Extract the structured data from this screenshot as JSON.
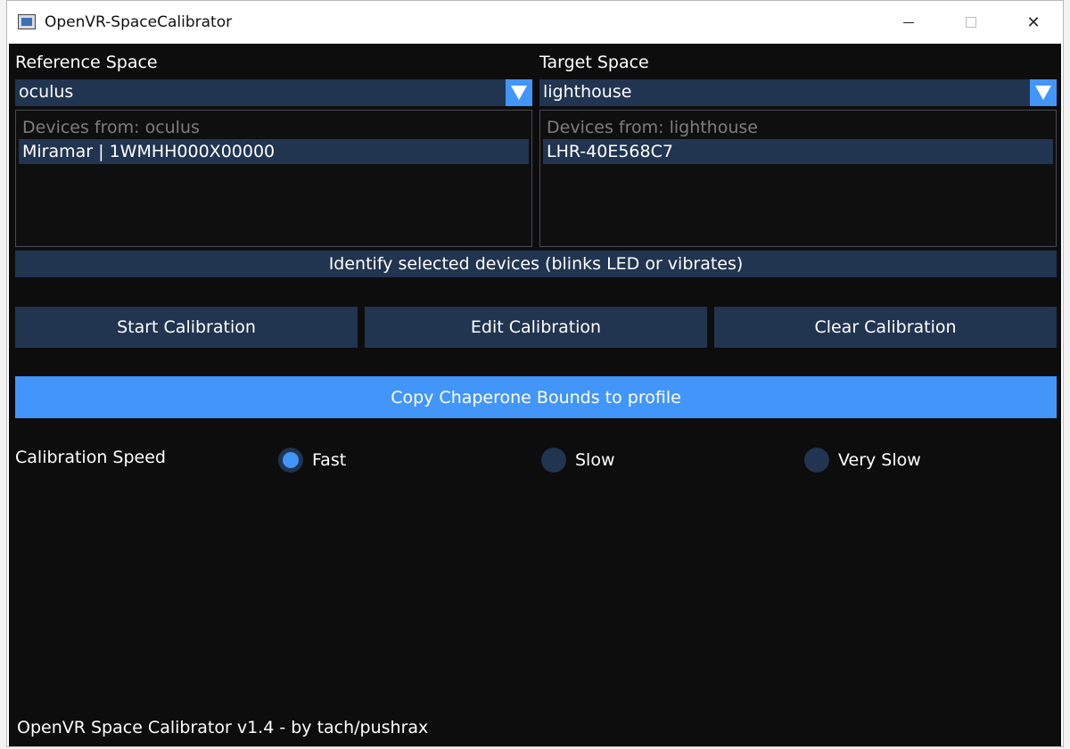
{
  "window": {
    "title": "OpenVR-SpaceCalibrator"
  },
  "reference": {
    "label": "Reference Space",
    "selected": "oculus",
    "list_header": "Devices from: oculus",
    "devices": [
      "Miramar | 1WMHH000X00000"
    ]
  },
  "target": {
    "label": "Target Space",
    "selected": "lighthouse",
    "list_header": "Devices from: lighthouse",
    "devices": [
      "LHR-40E568C7"
    ]
  },
  "buttons": {
    "identify": "Identify selected devices (blinks LED or vibrates)",
    "start": "Start Calibration",
    "edit": "Edit Calibration",
    "clear": "Clear Calibration",
    "copy_chaperone": "Copy Chaperone Bounds to profile"
  },
  "speed": {
    "label": "Calibration Speed",
    "options": [
      "Fast",
      "Slow",
      "Very Slow"
    ],
    "selected": "Fast"
  },
  "footer": "OpenVR Space Calibrator v1.4 - by tach/pushrax",
  "colors": {
    "background": "#0d0d0e",
    "button": "#213450",
    "accent": "#4296fa"
  }
}
